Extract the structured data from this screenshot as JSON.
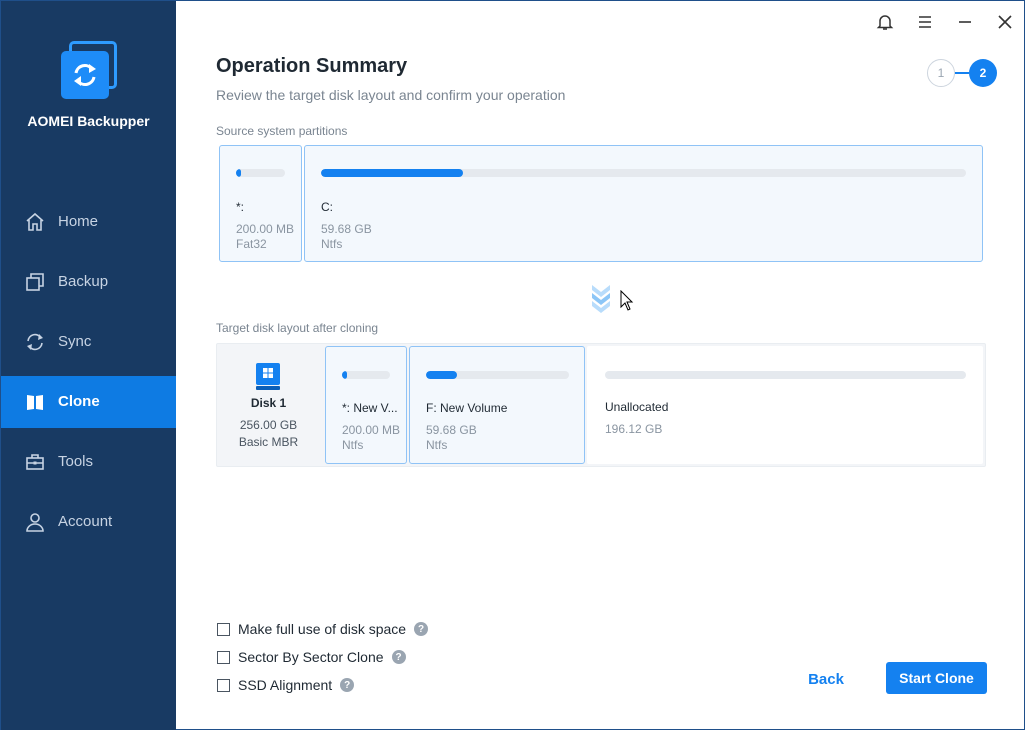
{
  "app": {
    "name": "AOMEI Backupper"
  },
  "nav": [
    {
      "label": "Home",
      "icon": "home-icon"
    },
    {
      "label": "Backup",
      "icon": "backup-icon"
    },
    {
      "label": "Sync",
      "icon": "sync-icon"
    },
    {
      "label": "Clone",
      "icon": "clone-icon",
      "active": true
    },
    {
      "label": "Tools",
      "icon": "tools-icon"
    },
    {
      "label": "Account",
      "icon": "account-icon"
    }
  ],
  "header": {
    "title": "Operation Summary",
    "subtitle": "Review the target disk layout and confirm your operation",
    "steps": [
      "1",
      "2"
    ]
  },
  "source": {
    "label": "Source system partitions",
    "partitions": [
      {
        "name": "*:",
        "size": "200.00 MB",
        "fs": "Fat32",
        "used_fraction": 0.1
      },
      {
        "name": "C:",
        "size": "59.68 GB",
        "fs": "Ntfs",
        "used_fraction": 0.22
      }
    ]
  },
  "target": {
    "label": "Target disk layout after cloning",
    "disk": {
      "name": "Disk 1",
      "size": "256.00 GB",
      "type": "Basic MBR"
    },
    "partitions": [
      {
        "name": "*: New V...",
        "size": "200.00 MB",
        "fs": "Ntfs",
        "used_fraction": 0.1
      },
      {
        "name": "F: New Volume",
        "size": "59.68 GB",
        "fs": "Ntfs",
        "used_fraction": 0.22
      },
      {
        "name": "Unallocated",
        "size": "196.12 GB",
        "used_fraction": 0
      }
    ]
  },
  "options": [
    {
      "label": "Make full use of disk space",
      "checked": false
    },
    {
      "label": "Sector By Sector Clone",
      "checked": false
    },
    {
      "label": "SSD Alignment",
      "checked": false
    }
  ],
  "buttons": {
    "back": "Back",
    "start": "Start Clone"
  },
  "colors": {
    "sidebar": "#183a63",
    "accent": "#1481f0",
    "active_nav": "#0e7be3"
  }
}
